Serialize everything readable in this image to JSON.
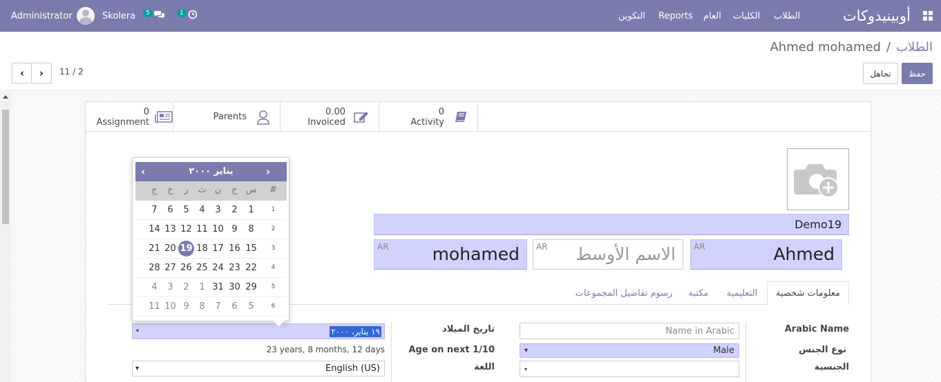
{
  "navbar": {
    "user_name": "Administrator",
    "company": "Skolera",
    "chat_count": "5",
    "activity_count": "1",
    "brand": "أوبينيدوكات",
    "menu": [
      "الطلاب",
      "الكليات",
      "العام",
      "Reports",
      "التكوين"
    ]
  },
  "breadcrumb": {
    "parent": "الطلاب",
    "separator": "/",
    "current": "Ahmed mohamed"
  },
  "buttons": {
    "save": "حفظ",
    "discard": "تجاهل"
  },
  "pager": {
    "value": "11 / 2"
  },
  "smart_buttons": [
    {
      "value": "0",
      "label": "Activity",
      "icon": "book-icon"
    },
    {
      "value": "0.00",
      "label": "Invoiced",
      "icon": "edit-icon"
    },
    {
      "value": "",
      "label": "Parents",
      "icon": "user-icon"
    },
    {
      "value": "0",
      "label": "Assignment",
      "icon": "newspaper-icon"
    }
  ],
  "form": {
    "student_id": "Demo19",
    "first_name": "Ahmed",
    "middle_name_placeholder": "الاسم الأوسط",
    "last_name": "mohamed",
    "lang_tag": "AR",
    "tabs": [
      "معلومات شخصية",
      "التعليمية",
      "مكتبة",
      "رسوم تفاصيل المجموعات"
    ],
    "labels": {
      "arabic_name": "Arabic Name",
      "gender": "نوع الجنس",
      "nationality": "الجنسية",
      "birth_date": "تاريخ الميلاد",
      "age_next": "Age on next 1/10",
      "language": "اللغة"
    },
    "arabic_name_placeholder": "Name in Arabic",
    "gender_value": "Male",
    "birth_date_value": "١٩ يناير، ٢٠٠٠",
    "age_value": "23 years, 8 months, 12 days",
    "language_value": "English (US)"
  },
  "datepicker": {
    "title": "يناير ٢٠٠٠",
    "weekdays": [
      "#",
      "س",
      "ح",
      "ن",
      "ث",
      "ر",
      "خ",
      "ج"
    ],
    "weeks": [
      {
        "week": "1",
        "days": [
          "1",
          "2",
          "3",
          "4",
          "5",
          "6",
          "7"
        ]
      },
      {
        "week": "2",
        "days": [
          "8",
          "9",
          "10",
          "11",
          "12",
          "13",
          "14"
        ]
      },
      {
        "week": "3",
        "days": [
          "15",
          "16",
          "17",
          "18",
          "19",
          "20",
          "21"
        ]
      },
      {
        "week": "4",
        "days": [
          "22",
          "23",
          "24",
          "25",
          "26",
          "27",
          "28"
        ]
      },
      {
        "week": "5",
        "days": [
          "29",
          "30",
          "31",
          "1",
          "2",
          "3",
          "4"
        ]
      },
      {
        "week": "6",
        "days": [
          "5",
          "6",
          "7",
          "8",
          "9",
          "10",
          "11"
        ]
      }
    ],
    "selected_day": "19",
    "colors": {
      "header": "#7c7bad",
      "selected": "#7c7bad"
    }
  },
  "colors": {
    "primary": "#7c7bad",
    "required_field": "#d2d2ff",
    "badge": "#00a09d"
  }
}
